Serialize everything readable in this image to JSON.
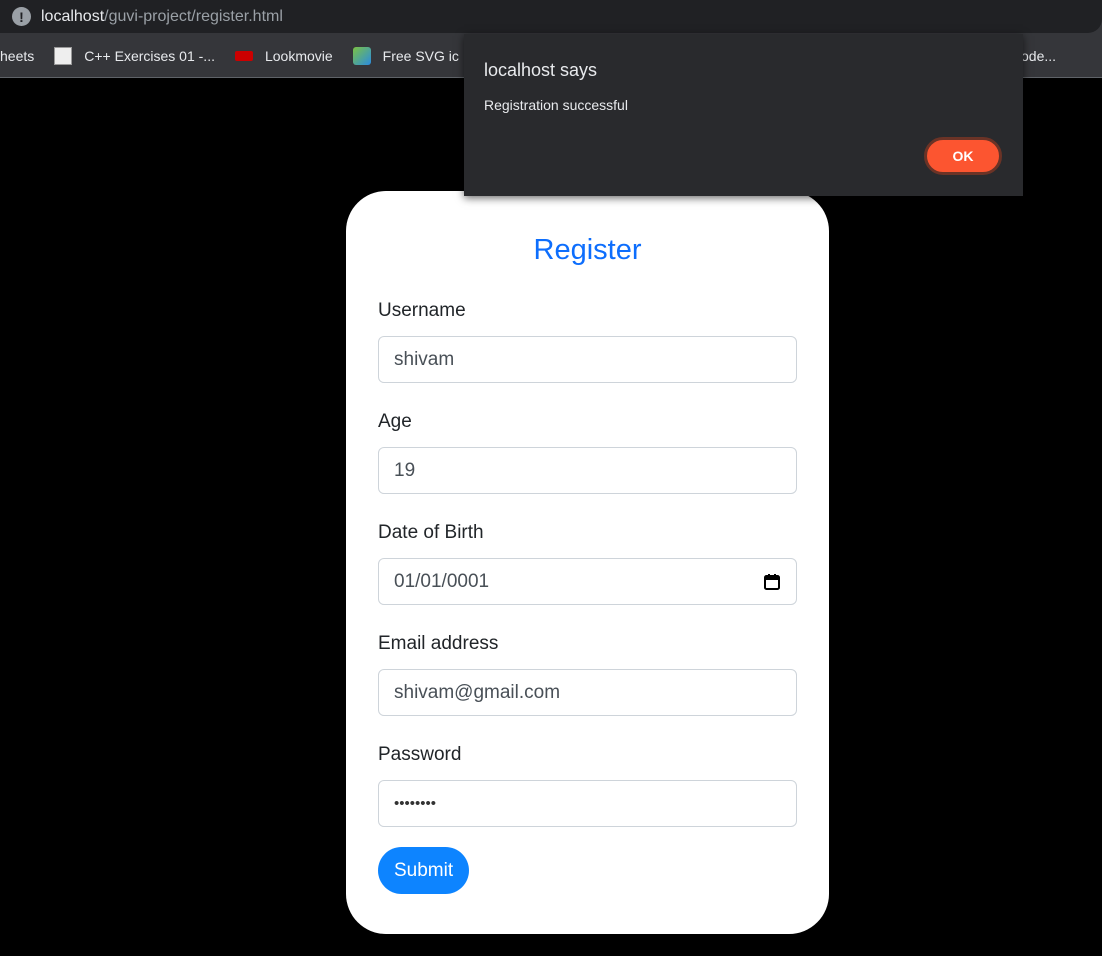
{
  "browser": {
    "url_host": "localhost",
    "url_path": "/guvi-project/register.html",
    "bookmarks": [
      {
        "label": "heets"
      },
      {
        "label": "C++ Exercises 01 -..."
      },
      {
        "label": "Lookmovie"
      },
      {
        "label": "Free SVG ic"
      }
    ],
    "bookmark_tail": "ode..."
  },
  "form": {
    "title": "Register",
    "fields": [
      {
        "label": "Username",
        "value": "shivam"
      },
      {
        "label": "Age",
        "value": "19"
      },
      {
        "label": "Date of Birth",
        "value": "01/01/0001"
      },
      {
        "label": "Email address",
        "value": "shivam@gmail.com"
      },
      {
        "label": "Password",
        "value": "••••••••"
      }
    ],
    "submit": "Submit"
  },
  "dialog": {
    "title": "localhost says",
    "message": "Registration successful",
    "ok": "OK"
  }
}
